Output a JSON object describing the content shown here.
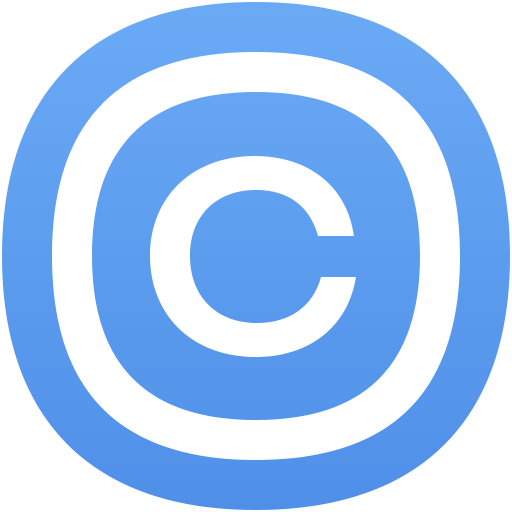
{
  "app_icon": {
    "icon": "copyright-icon",
    "colors": {
      "background_top": "#6aaaf5",
      "background_bottom": "#4f8fe8",
      "foreground": "#ffffff"
    }
  }
}
